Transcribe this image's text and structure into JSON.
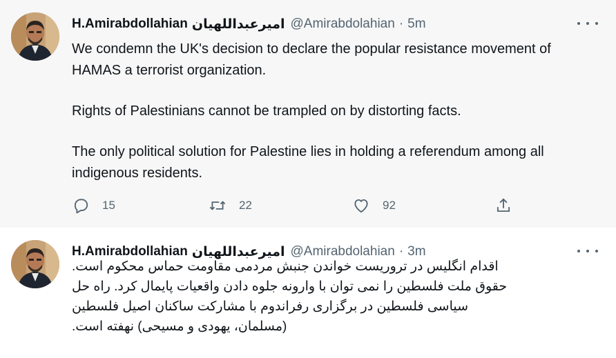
{
  "tweets": [
    {
      "display_name": "H.Amirabdollahian",
      "display_name_fa": "امیرعبداللهیان",
      "handle": "@Amirabdolahian",
      "separator": "·",
      "time": "5m",
      "text_lines": [
        "We condemn the UK's decision to declare the popular resistance movement of HAMAS a terrorist organization.",
        "Rights of Palestinians cannot be trampled on by distorting facts.",
        "The only political solution for Palestine lies in holding a referendum among all indigenous residents."
      ],
      "replies": "15",
      "retweets": "22",
      "likes": "92"
    },
    {
      "display_name": "H.Amirabdollahian",
      "display_name_fa": "امیرعبداللهیان",
      "handle": "@Amirabdolahian",
      "separator": "·",
      "time": "3m",
      "text_lines": [
        "اقدام انگلیس در تروریست خواندن جنبش مردمی مقاومت حماس محکوم است.",
        "حقوق ملت فلسطین را نمی توان با وارونه جلوه دادن واقعیات پایمال کرد. راه حل",
        "سیاسی فلسطین در برگزاری رفراندوم با مشارکت ساکنان اصیل فلسطین",
        "(مسلمان، یهودی و مسیحی) نهفته است."
      ]
    }
  ],
  "icons": {
    "reply": "reply-icon",
    "retweet": "retweet-icon",
    "like": "heart-icon",
    "share": "share-icon",
    "more": "more-icon"
  },
  "colors": {
    "text": "#0f1419",
    "secondary": "#536471",
    "thread_line": "#cfd9de",
    "tweet1_bg": "#f7f7f7"
  }
}
